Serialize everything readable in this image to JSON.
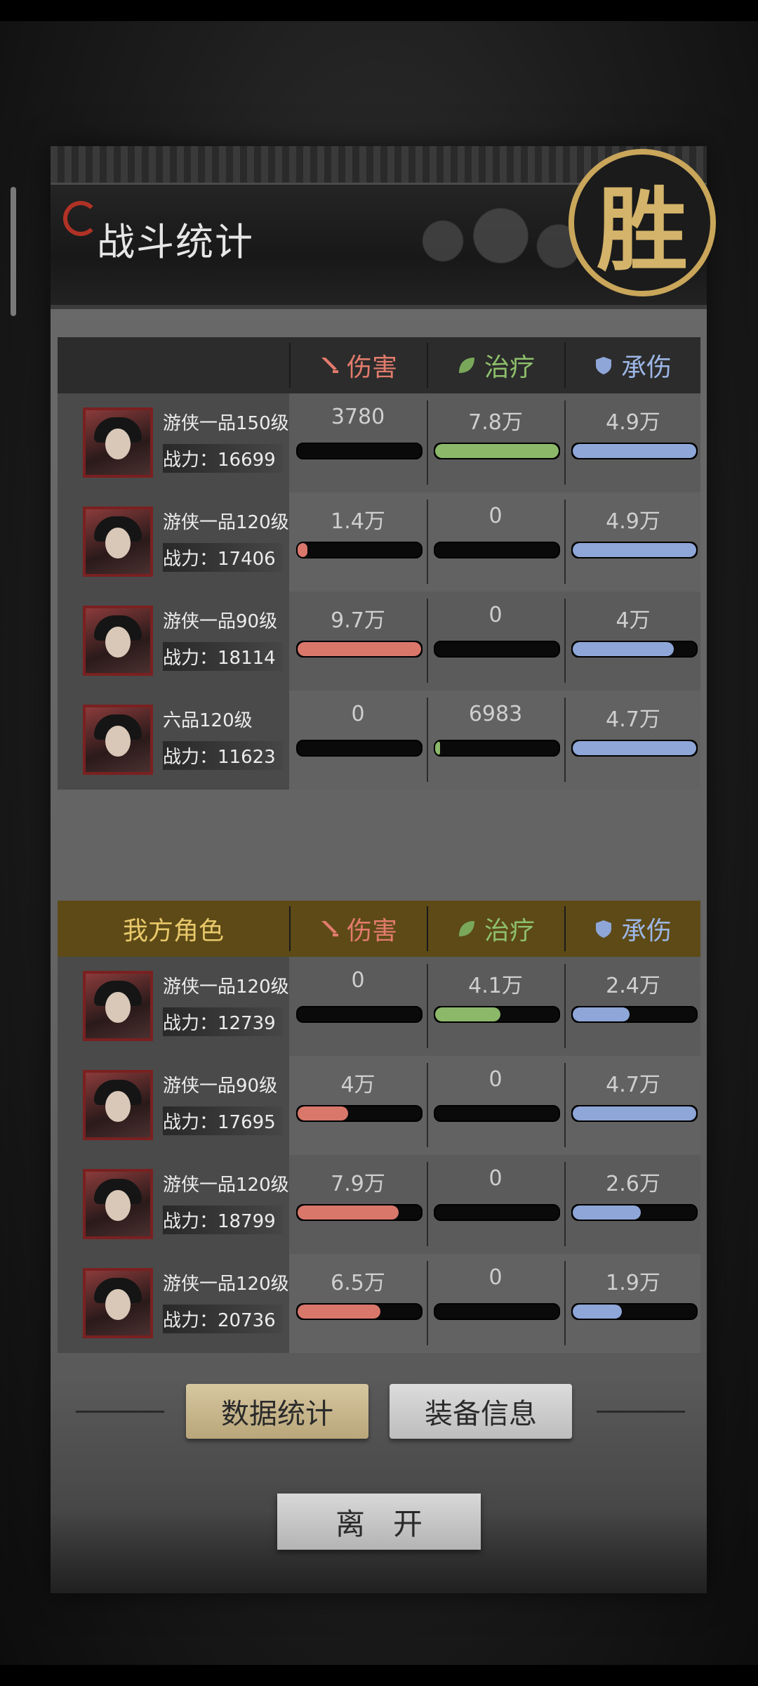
{
  "panel": {
    "title": "战斗统计",
    "result_badge": "胜"
  },
  "columns": {
    "damage": "伤害",
    "healing": "治疗",
    "taken": "承伤",
    "damage_color": "#e27b6c",
    "healing_color": "#8ec06c",
    "taken_color": "#9cb6e6"
  },
  "enemy_team": {
    "header": "",
    "rows": [
      {
        "name": "游侠一品150级",
        "power_label": "战力：",
        "power": "16699",
        "damage": "3780",
        "damage_fill": 0.0,
        "healing": "7.8万",
        "healing_fill": 1.0,
        "taken": "4.9万",
        "taken_fill": 1.0
      },
      {
        "name": "游侠一品120级",
        "power_label": "战力：",
        "power": "17406",
        "damage": "1.4万",
        "damage_fill": 0.08,
        "healing": "0",
        "healing_fill": 0.0,
        "taken": "4.9万",
        "taken_fill": 1.0
      },
      {
        "name": "游侠一品90级",
        "power_label": "战力：",
        "power": "18114",
        "damage": "9.7万",
        "damage_fill": 1.0,
        "healing": "0",
        "healing_fill": 0.0,
        "taken": "4万",
        "taken_fill": 0.82
      },
      {
        "name": "六品120级",
        "power_label": "战力：",
        "power": "11623",
        "damage": "0",
        "damage_fill": 0.0,
        "healing": "6983",
        "healing_fill": 0.04,
        "taken": "4.7万",
        "taken_fill": 1.0
      }
    ]
  },
  "ally_team": {
    "header": "我方角色",
    "rows": [
      {
        "name": "游侠一品120级",
        "power_label": "战力：",
        "power": "12739",
        "damage": "0",
        "damage_fill": 0.0,
        "healing": "4.1万",
        "healing_fill": 0.53,
        "taken": "2.4万",
        "taken_fill": 0.46
      },
      {
        "name": "游侠一品90级",
        "power_label": "战力：",
        "power": "17695",
        "damage": "4万",
        "damage_fill": 0.41,
        "healing": "0",
        "healing_fill": 0.0,
        "taken": "4.7万",
        "taken_fill": 1.0
      },
      {
        "name": "游侠一品120级",
        "power_label": "战力：",
        "power": "18799",
        "damage": "7.9万",
        "damage_fill": 0.82,
        "healing": "0",
        "healing_fill": 0.0,
        "taken": "2.6万",
        "taken_fill": 0.55
      },
      {
        "name": "游侠一品120级",
        "power_label": "战力：",
        "power": "20736",
        "damage": "6.5万",
        "damage_fill": 0.67,
        "healing": "0",
        "healing_fill": 0.0,
        "taken": "1.9万",
        "taken_fill": 0.4
      }
    ]
  },
  "tabs": {
    "data_stats": "数据统计",
    "equipment_info": "装备信息"
  },
  "leave_button": "离开"
}
